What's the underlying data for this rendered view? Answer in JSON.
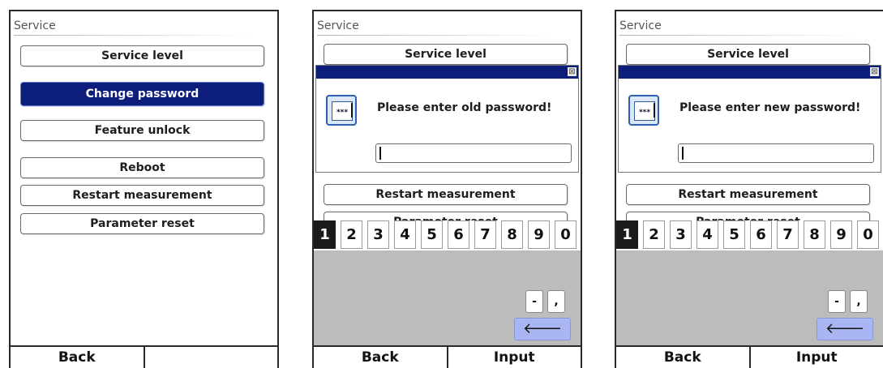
{
  "screens": [
    {
      "title": "Service",
      "menu": [
        {
          "label": "Service level",
          "selected": false
        },
        {
          "label": "Change password",
          "selected": true
        },
        {
          "label": "Feature unlock",
          "selected": false
        },
        {
          "label": "Reboot",
          "selected": false
        },
        {
          "label": "Restart measurement",
          "selected": false
        },
        {
          "label": "Parameter reset",
          "selected": false
        }
      ],
      "footer": {
        "left": "Back",
        "right": ""
      }
    },
    {
      "title": "Service",
      "menu_visible": [
        "Service level",
        "Restart measurement",
        "Parameter reset"
      ],
      "dialog": {
        "message": "Please enter old password!",
        "icon_text": "***",
        "close": "⊠",
        "input_value": ""
      },
      "keypad": {
        "digits": [
          "1",
          "2",
          "3",
          "4",
          "5",
          "6",
          "7",
          "8",
          "9",
          "0"
        ],
        "active_digit": "1",
        "minus": "-",
        "comma": ",",
        "backspace": "🡐"
      },
      "footer": {
        "left": "Back",
        "right": "Input"
      }
    },
    {
      "title": "Service",
      "menu_visible": [
        "Service level",
        "Restart measurement",
        "Parameter reset"
      ],
      "dialog": {
        "message": "Please enter new password!",
        "icon_text": "***",
        "close": "⊠",
        "input_value": ""
      },
      "keypad": {
        "digits": [
          "1",
          "2",
          "3",
          "4",
          "5",
          "6",
          "7",
          "8",
          "9",
          "0"
        ],
        "active_digit": "1",
        "minus": "-",
        "comma": ",",
        "backspace": "🡐"
      },
      "footer": {
        "left": "Back",
        "right": "Input"
      }
    }
  ],
  "colors": {
    "selection": "#0c1d7c",
    "dialog_bar": "#0c1d7c",
    "keypad_bg": "#bcbcbc",
    "backspace_key": "#aab6f3"
  }
}
